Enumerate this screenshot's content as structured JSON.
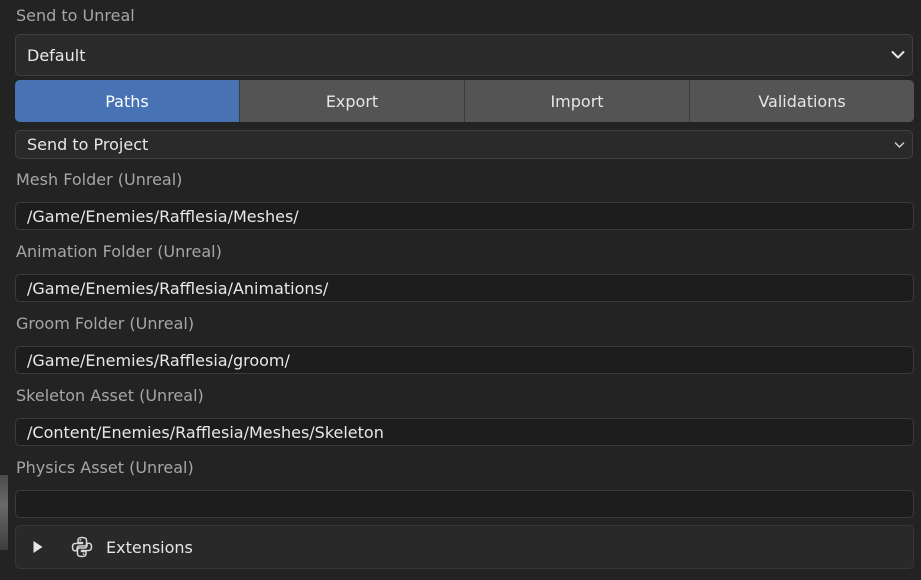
{
  "panel": {
    "title": "Send to Unreal",
    "preset": {
      "value": "Default",
      "icon": "chevron-down-icon"
    }
  },
  "tabs": [
    {
      "label": "Paths",
      "active": true
    },
    {
      "label": "Export",
      "active": false
    },
    {
      "label": "Import",
      "active": false
    },
    {
      "label": "Validations",
      "active": false
    }
  ],
  "paths": {
    "path_mode": {
      "value": "Send to Project",
      "icon": "chevron-down-icon"
    },
    "mesh_folder": {
      "label": "Mesh Folder (Unreal)",
      "value": "/Game/Enemies/Rafflesia/Meshes/"
    },
    "animation_folder": {
      "label": "Animation Folder (Unreal)",
      "value": "/Game/Enemies/Rafflesia/Animations/"
    },
    "groom_folder": {
      "label": "Groom Folder (Unreal)",
      "value": "/Game/Enemies/Rafflesia/groom/"
    },
    "skeleton_asset": {
      "label": "Skeleton Asset (Unreal)",
      "value": "/Content/Enemies/Rafflesia/Meshes/Skeleton"
    },
    "physics_asset": {
      "label": "Physics Asset (Unreal)",
      "value": ""
    }
  },
  "extensions": {
    "label": "Extensions",
    "expanded": false,
    "icons": [
      "disclosure-triangle-icon",
      "python-icon"
    ]
  },
  "colors": {
    "background": "#232323",
    "active_tab": "#4772b3",
    "tab": "#545454",
    "field": "#1d1d1d",
    "label_text": "#a6a6a6"
  }
}
